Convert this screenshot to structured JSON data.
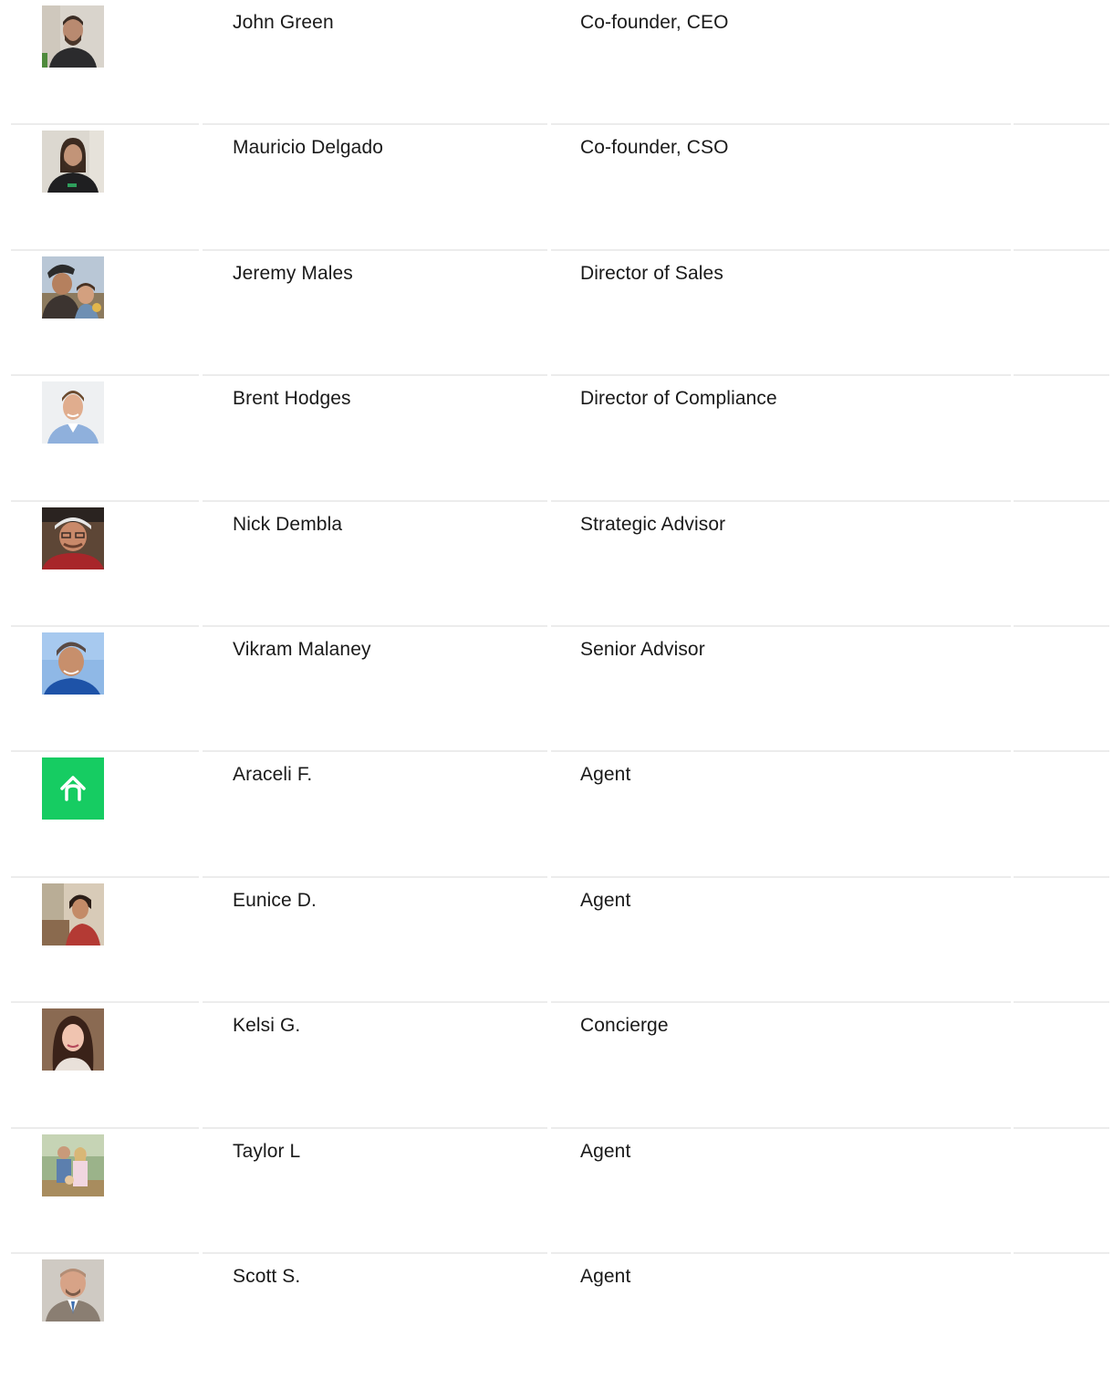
{
  "team": {
    "members": [
      {
        "name": "John Green",
        "role": "Co-founder, CEO",
        "avatar": "photo-man-beard-dark-shirt"
      },
      {
        "name": "Mauricio Delgado",
        "role": "Co-founder, CSO",
        "avatar": "photo-man-long-hair-dark-shirt"
      },
      {
        "name": "Jeremy Males",
        "role": "Director of Sales",
        "avatar": "photo-man-cap-with-child"
      },
      {
        "name": "Brent Hodges",
        "role": "Director of Compliance",
        "avatar": "photo-man-blue-shirt"
      },
      {
        "name": "Nick Dembla",
        "role": "Strategic Advisor",
        "avatar": "photo-man-red-shirt"
      },
      {
        "name": "Vikram Malaney",
        "role": "Senior Advisor",
        "avatar": "photo-man-sky-background"
      },
      {
        "name": "Araceli F.",
        "role": "Agent",
        "avatar": "brand-house-logo-icon"
      },
      {
        "name": "Eunice D.",
        "role": "Agent",
        "avatar": "photo-woman-red-top"
      },
      {
        "name": "Kelsi G.",
        "role": "Concierge",
        "avatar": "photo-woman-dark-hair"
      },
      {
        "name": "Taylor L",
        "role": "Agent",
        "avatar": "photo-couple-outdoors"
      },
      {
        "name": "Scott S.",
        "role": "Agent",
        "avatar": "photo-man-suit"
      }
    ]
  },
  "colors": {
    "brand_green": "#16cc62",
    "divider": "#ececec",
    "text": "#1a1a1a"
  }
}
